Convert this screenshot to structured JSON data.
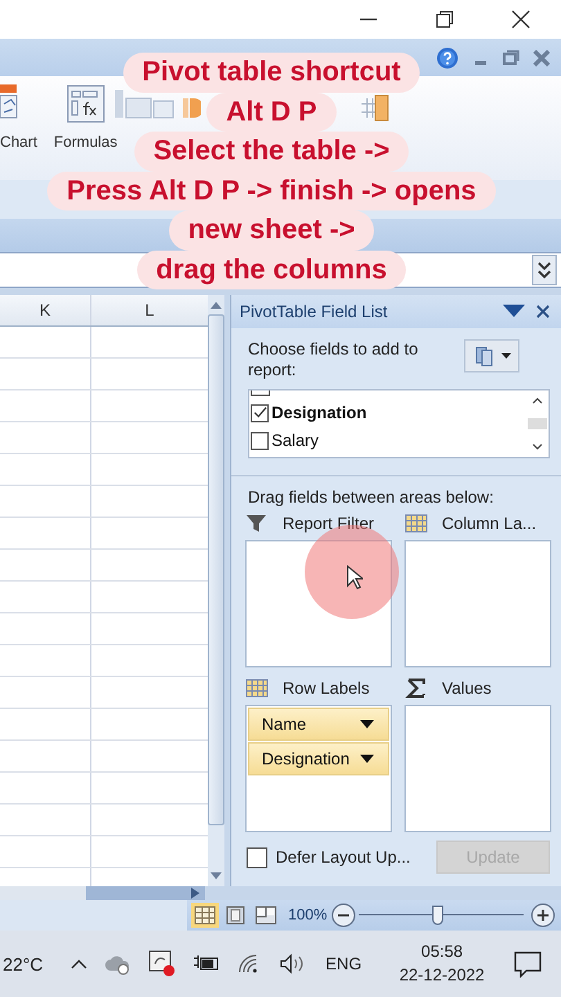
{
  "ribbon": {
    "labels": [
      "Chart",
      "Formulas"
    ]
  },
  "sheet": {
    "columns": [
      "K",
      "L"
    ]
  },
  "pivot_panel": {
    "title": "PivotTable Field List",
    "prompt": "Choose fields to add to report:",
    "fields": [
      {
        "label": "Designation",
        "checked": true
      },
      {
        "label": "Salary",
        "checked": false
      }
    ],
    "areas_hint": "Drag fields between areas below:",
    "areas": [
      {
        "kind": "filter",
        "label": "Report Filter"
      },
      {
        "kind": "columns",
        "label": "Column La..."
      },
      {
        "kind": "rows",
        "label": "Row Labels",
        "items": [
          "Name",
          "Designation"
        ]
      },
      {
        "kind": "values",
        "label": "Values"
      }
    ],
    "defer": {
      "label": "Defer Layout Up...",
      "checked": false
    },
    "update_button": {
      "label": "Update",
      "disabled": true
    }
  },
  "status_bar": {
    "views": [
      {
        "kind": "normal",
        "selected": true
      },
      {
        "kind": "layout",
        "selected": false
      },
      {
        "kind": "break",
        "selected": false
      }
    ],
    "zoom": "100%",
    "zoom_slider": {
      "level": 0.48
    }
  },
  "taskbar": {
    "temperature": "22°C",
    "language": "ENG",
    "time": "05:58",
    "date": "22-12-2022"
  },
  "caption": {
    "lines": [
      "Pivot table shortcut",
      "Alt D P",
      "Select the table ->",
      "Press Alt D P -> finish -> opens",
      "new sheet ->",
      "drag the columns"
    ]
  }
}
